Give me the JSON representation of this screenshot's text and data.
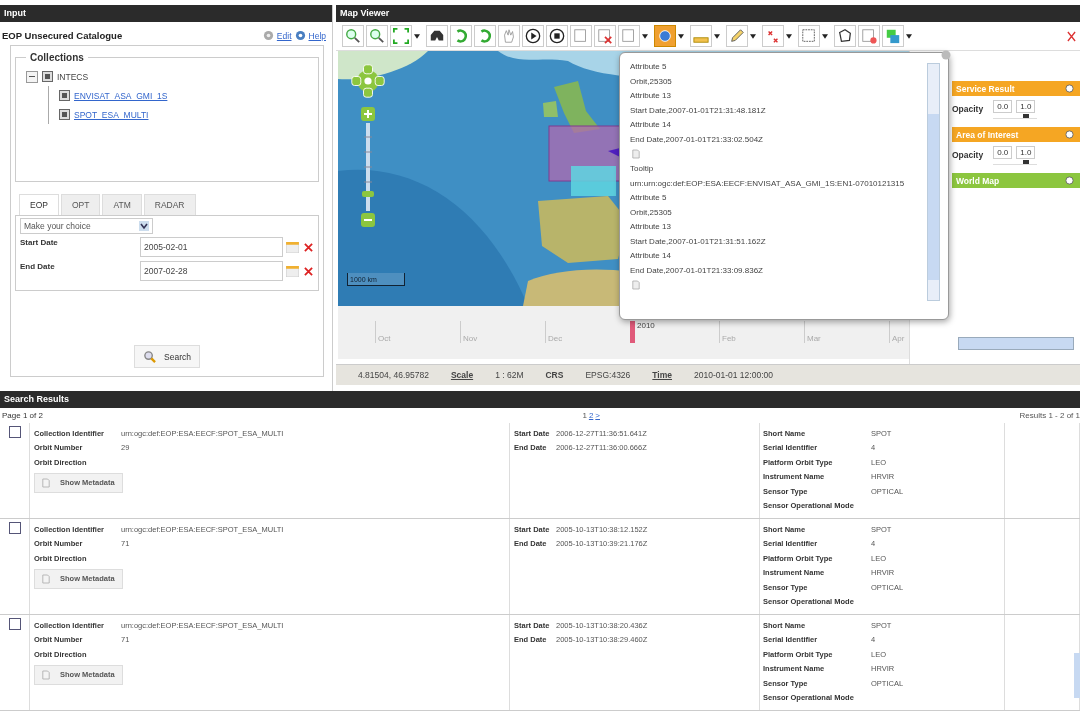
{
  "input_panel": {
    "title": "Input",
    "catalogue": "EOP Unsecured Catalogue",
    "links": [
      "Edit",
      "Help"
    ],
    "collections": {
      "legend": "Collections",
      "tree": [
        {
          "label": "INTECS",
          "checked": true,
          "expanded": true,
          "children": [
            {
              "label": "ENVISAT_ASA_GMI_1S",
              "checked": true
            },
            {
              "label": "SPOT_ESA_MULTI",
              "checked": true
            }
          ]
        }
      ]
    },
    "tabs": [
      {
        "label": "EOP",
        "selected": true
      },
      {
        "label": "OPT",
        "selected": false
      },
      {
        "label": "ATM",
        "selected": false
      },
      {
        "label": "RADAR",
        "selected": false
      }
    ],
    "dropdown": {
      "value": "Make your choice"
    },
    "dates": [
      {
        "label": "Start Date",
        "value": "2005-02-01"
      },
      {
        "label": "End Date",
        "value": "2007-02-28"
      }
    ],
    "search_button": "Search"
  },
  "map_viewer": {
    "title": "Map Viewer",
    "tools": [
      {
        "selected": false
      },
      {
        "selected": false
      },
      {
        "selected": false
      },
      {
        "selected": false
      },
      {
        "selected": false
      },
      {
        "selected": false
      },
      {
        "selected": false
      },
      {
        "selected": false
      },
      {
        "selected": false
      },
      {
        "selected": false
      },
      {
        "selected": false
      },
      {
        "selected": false
      },
      {
        "selected": true
      },
      {
        "selected": false
      },
      {
        "selected": false
      },
      {
        "selected": false
      },
      {
        "selected": false
      },
      {
        "selected": false
      },
      {
        "selected": false
      },
      {
        "selected": false
      }
    ],
    "scale_bar": "1000 km",
    "timeline": [
      {
        "label": "Oct",
        "selected": false
      },
      {
        "label": "Nov",
        "selected": false
      },
      {
        "label": "Dec",
        "selected": false
      },
      {
        "label": "2010",
        "selected": true
      },
      {
        "label": "Feb",
        "selected": false
      },
      {
        "label": "Mar",
        "selected": false
      },
      {
        "label": "Apr",
        "selected": false
      }
    ],
    "popup": [
      {
        "kind": "text",
        "text": "Attribute 5"
      },
      {
        "kind": "text",
        "text": "Orbit,25305"
      },
      {
        "kind": "text",
        "text": "Attribute 13"
      },
      {
        "kind": "text",
        "text": "Start Date,2007-01-01T21:31:48.181Z"
      },
      {
        "kind": "text",
        "text": "Attribute 14"
      },
      {
        "kind": "text",
        "text": "End Date,2007-01-01T21:33:02.504Z"
      },
      {
        "kind": "icon"
      },
      {
        "kind": "text",
        "text": "Tooltip"
      },
      {
        "kind": "text",
        "text": "urn:urn:ogc:def:EOP:ESA:EECF:ENVISAT_ASA_GMI_1S:EN1-07010121315"
      },
      {
        "kind": "text",
        "text": "Attribute 5"
      },
      {
        "kind": "text",
        "text": "Orbit,25305"
      },
      {
        "kind": "text",
        "text": "Attribute 13"
      },
      {
        "kind": "text",
        "text": "Start Date,2007-01-01T21:31:51.162Z"
      },
      {
        "kind": "text",
        "text": "Attribute 14"
      },
      {
        "kind": "text",
        "text": "End Date,2007-01-01T21:33:09.836Z"
      },
      {
        "kind": "icon"
      }
    ],
    "layers": [
      {
        "title": "Service Result",
        "color": "#f5a623",
        "opacity": {
          "label": "Opacity",
          "min": "0.0",
          "max": "1.0",
          "level": 0.75
        }
      },
      {
        "title": "Area of Interest",
        "color": "#f5a623",
        "opacity": {
          "label": "Opacity",
          "min": "0.0",
          "max": "1.0",
          "level": 0.75
        }
      },
      {
        "title": "World Map",
        "color": "#8cc63f"
      }
    ],
    "status": {
      "coordinates": "4.81504, 46.95782",
      "scale_label": "Scale",
      "scale": "1 : 62M",
      "crs_label": "CRS",
      "crs": "EPSG:4326",
      "time_label": "Time",
      "time": "2010-01-01 12:00:00"
    }
  },
  "search_results": {
    "title": "Search Results",
    "page": "Page 1 of 2",
    "pager": [
      {
        "label": "1",
        "selected": true
      },
      {
        "label": "2",
        "selected": false
      },
      {
        "label": ">",
        "selected": false
      }
    ],
    "count": "Results 1 - 2 of 1",
    "rows": [
      {
        "checked": false,
        "button": "Show Metadata",
        "left": [
          {
            "label": "Collection Identifier",
            "value": "urn:ogc:def:EOP:ESA:EECF:SPOT_ESA_MULTI"
          },
          {
            "label": "Orbit Number",
            "value": "29"
          },
          {
            "label": "Orbit Direction"
          }
        ],
        "middle": [
          {
            "label": "Start Date",
            "value": "2006-12-27T11:36:51.641Z"
          },
          {
            "label": "End Date",
            "value": "2006-12-27T11:36:00.666Z"
          }
        ],
        "right": [
          {
            "label": "Short Name",
            "value": "SPOT"
          },
          {
            "label": "Serial Identifier",
            "value": "4"
          },
          {
            "label": "Platform Orbit Type",
            "value": "LEO"
          },
          {
            "label": "Instrument Name",
            "value": "HRVIR"
          },
          {
            "label": "Sensor Type",
            "value": "OPTICAL"
          },
          {
            "label": "Sensor Operational Mode"
          }
        ]
      },
      {
        "checked": false,
        "button": "Show Metadata",
        "left": [
          {
            "label": "Collection Identifier",
            "value": "urn:ogc:def:EOP:ESA:EECF:SPOT_ESA_MULTI"
          },
          {
            "label": "Orbit Number",
            "value": "71"
          },
          {
            "label": "Orbit Direction"
          }
        ],
        "middle": [
          {
            "label": "Start Date",
            "value": "2005-10-13T10:38:12.152Z"
          },
          {
            "label": "End Date",
            "value": "2005-10-13T10:39:21.176Z"
          }
        ],
        "right": [
          {
            "label": "Short Name",
            "value": "SPOT"
          },
          {
            "label": "Serial Identifier",
            "value": "4"
          },
          {
            "label": "Platform Orbit Type",
            "value": "LEO"
          },
          {
            "label": "Instrument Name",
            "value": "HRVIR"
          },
          {
            "label": "Sensor Type",
            "value": "OPTICAL"
          },
          {
            "label": "Sensor Operational Mode"
          }
        ]
      },
      {
        "checked": false,
        "button": "Show Metadata",
        "left": [
          {
            "label": "Collection Identifier",
            "value": "urn:ogc:def:EOP:ESA:EECF:SPOT_ESA_MULTI"
          },
          {
            "label": "Orbit Number",
            "value": "71"
          },
          {
            "label": "Orbit Direction"
          }
        ],
        "middle": [
          {
            "label": "Start Date",
            "value": "2005-10-13T10:38:20.436Z"
          },
          {
            "label": "End Date",
            "value": "2005-10-13T10:38:29.460Z"
          }
        ],
        "right": [
          {
            "label": "Short Name",
            "value": "SPOT"
          },
          {
            "label": "Serial Identifier",
            "value": "4"
          },
          {
            "label": "Platform Orbit Type",
            "value": "LEO"
          },
          {
            "label": "Instrument Name",
            "value": "HRVIR"
          },
          {
            "label": "Sensor Type",
            "value": "OPTICAL"
          },
          {
            "label": "Sensor Operational Mode"
          }
        ]
      }
    ]
  }
}
